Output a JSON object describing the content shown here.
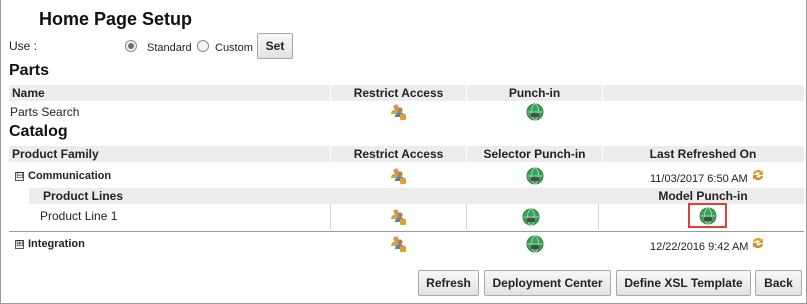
{
  "page": {
    "title": "Home Page Setup"
  },
  "use": {
    "label": "Use :",
    "options": [
      {
        "label": "Standard",
        "selected": true
      },
      {
        "label": "Custom",
        "selected": false
      }
    ],
    "set_button": "Set"
  },
  "parts": {
    "heading": "Parts",
    "columns": [
      "Name",
      "Restrict Access",
      "Punch-in"
    ],
    "rows": [
      {
        "name": "Parts Search"
      }
    ]
  },
  "catalog": {
    "heading": "Catalog",
    "columns": [
      "Product Family",
      "Restrict Access",
      "Selector Punch-in",
      "Last Refreshed On"
    ],
    "families": [
      {
        "name": "Communication",
        "expanded": true,
        "expander": "⊟",
        "last_refreshed": "11/03/2017 6:50 AM",
        "sub_columns": [
          "Product Lines",
          "Model Punch-in"
        ],
        "lines": [
          {
            "name": "Product Line 1"
          }
        ]
      },
      {
        "name": "Integration",
        "expanded": false,
        "expander": "⊞",
        "last_refreshed": "12/22/2016 9:42 AM"
      }
    ]
  },
  "footer_buttons": {
    "refresh": "Refresh",
    "deployment_center": "Deployment Center",
    "define_xsl": "Define XSL Template",
    "back": "Back"
  },
  "colors": {
    "header_bg": "#ececec",
    "highlight": "#e0403a",
    "globe": "#3aa35a"
  },
  "icons": {
    "restrict_access": "users-lock-icon",
    "punch_in": "globe-link-icon",
    "refresh_sync": "sync-arrows-icon"
  }
}
